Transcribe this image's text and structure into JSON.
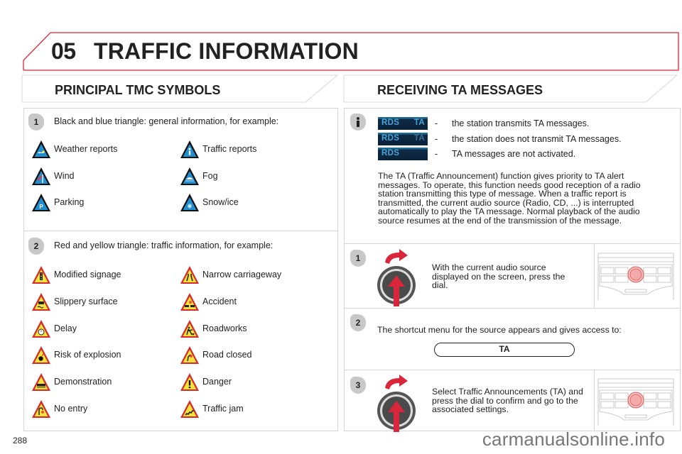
{
  "header": {
    "chapter_number": "05",
    "chapter_title": "TRAFFIC INFORMATION",
    "accent_color": "#d9263b"
  },
  "left_section": {
    "title": "PRINCIPAL TMC SYMBOLS",
    "group1": {
      "step": "1",
      "intro": "Black and blue triangle: general information, for example:",
      "items": [
        {
          "label": "Weather reports",
          "icon": "weather-triangle-icon"
        },
        {
          "label": "Traffic reports",
          "icon": "info-triangle-icon"
        },
        {
          "label": "Wind",
          "icon": "wind-triangle-icon"
        },
        {
          "label": "Fog",
          "icon": "fog-triangle-icon"
        },
        {
          "label": "Parking",
          "icon": "parking-triangle-icon"
        },
        {
          "label": "Snow/ice",
          "icon": "snow-triangle-icon"
        }
      ]
    },
    "group2": {
      "step": "2",
      "intro": "Red and yellow triangle: traffic information, for example:",
      "items": [
        {
          "label": "Modified signage",
          "icon": "traffic-light-triangle-icon"
        },
        {
          "label": "Narrow carriageway",
          "icon": "narrow-road-triangle-icon"
        },
        {
          "label": "Slippery surface",
          "icon": "slippery-triangle-icon"
        },
        {
          "label": "Accident",
          "icon": "accident-triangle-icon"
        },
        {
          "label": "Delay",
          "icon": "clock-triangle-icon"
        },
        {
          "label": "Roadworks",
          "icon": "roadworks-triangle-icon"
        },
        {
          "label": "Risk of explosion",
          "icon": "bomb-triangle-icon"
        },
        {
          "label": "Road closed",
          "icon": "road-closed-triangle-icon"
        },
        {
          "label": "Demonstration",
          "icon": "demonstration-triangle-icon"
        },
        {
          "label": "Danger",
          "icon": "exclamation-triangle-icon"
        },
        {
          "label": "No entry",
          "icon": "no-entry-triangle-icon"
        },
        {
          "label": "Traffic jam",
          "icon": "traffic-jam-triangle-icon"
        }
      ]
    }
  },
  "right_section": {
    "title": "RECEIVING TA MESSAGES",
    "info_rows": [
      {
        "badge_left": "RDS",
        "badge_right": "TA",
        "ta_state": "bright",
        "dash": "-",
        "text": "the station transmits TA messages."
      },
      {
        "badge_left": "RDS",
        "badge_right": "TA",
        "ta_state": "dim",
        "dash": "-",
        "text": "the station does not transmit TA messages."
      },
      {
        "badge_left": "RDS",
        "badge_right": "",
        "ta_state": "none",
        "dash": "-",
        "text": "TA messages are not activated."
      }
    ],
    "paragraph": "The TA (Traffic Announcement) function gives priority to TA alert messages. To operate, this function needs good reception of a radio station transmitting this type of message. When a traffic report is transmitted, the current audio source (Radio, CD, ...) is interrupted automatically to play the TA message. Normal playback of the audio source resumes at the end of the transmission of the message.",
    "steps": [
      {
        "number": "1",
        "text": "With the current audio source displayed on the screen, press the dial."
      },
      {
        "number": "2",
        "text": "The shortcut menu for the source appears and gives access to:",
        "menu_item": "TA"
      },
      {
        "number": "3",
        "text": "Select Traffic Announcements (TA) and press the dial to confirm and go to the associated settings."
      }
    ]
  },
  "footer": {
    "page_number": "288",
    "watermark": "carmanualsonline.info"
  }
}
